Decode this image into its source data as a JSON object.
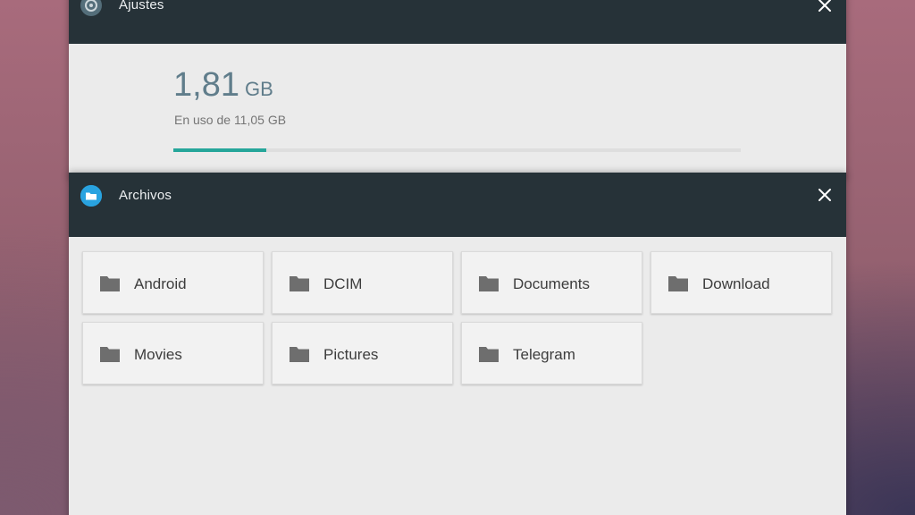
{
  "settings_window": {
    "title": "Ajustes",
    "icon": "gear-icon",
    "storage": {
      "used_value": "1,81",
      "used_unit": "GB",
      "total_text": "En uso de 11,05 GB",
      "used_fraction": 0.164
    },
    "accent_color": "#26a69a"
  },
  "files_window": {
    "title": "Archivos",
    "icon": "folder-icon",
    "icon_color": "#29a3e0",
    "folders": [
      {
        "name": "Android"
      },
      {
        "name": "DCIM"
      },
      {
        "name": "Documents"
      },
      {
        "name": "Download"
      },
      {
        "name": "Movies"
      },
      {
        "name": "Pictures"
      },
      {
        "name": "Telegram"
      }
    ]
  }
}
